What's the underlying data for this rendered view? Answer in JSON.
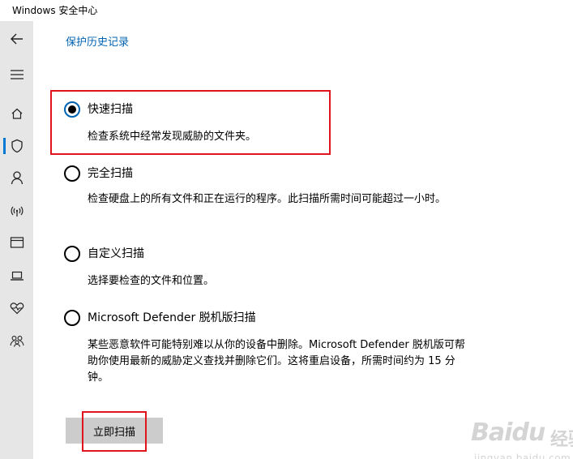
{
  "window": {
    "title": "Windows 安全中心"
  },
  "sidebar": {
    "items": [
      {
        "icon": "back-arrow-icon"
      },
      {
        "icon": "hamburger-menu-icon"
      },
      {
        "icon": "home-icon"
      },
      {
        "icon": "shield-icon",
        "active": true
      },
      {
        "icon": "person-icon"
      },
      {
        "icon": "network-icon"
      },
      {
        "icon": "app-browser-icon"
      },
      {
        "icon": "laptop-icon"
      },
      {
        "icon": "heart-health-icon"
      },
      {
        "icon": "family-icon"
      }
    ]
  },
  "content": {
    "history_link": "保护历史记录",
    "options": [
      {
        "label": "快速扫描",
        "description": "检查系统中经常发现威胁的文件夹。",
        "selected": true
      },
      {
        "label": "完全扫描",
        "description": "检查硬盘上的所有文件和正在运行的程序。此扫描所需时间可能超过一小时。",
        "selected": false
      },
      {
        "label": "自定义扫描",
        "description": "选择要检查的文件和位置。",
        "selected": false
      },
      {
        "label": "Microsoft Defender 脱机版扫描",
        "description": "某些恶意软件可能特别难以从你的设备中删除。Microsoft Defender 脱机版可帮助你使用最新的威胁定义查找并删除它们。这将重启设备，所需时间约为 15 分钟。",
        "selected": false
      }
    ],
    "scan_button": "立即扫描"
  },
  "watermark": {
    "main": "Baidu",
    "cn": "经验",
    "url": "jingyan.baidu.com"
  },
  "colors": {
    "accent": "#0078d4",
    "link": "#0063b1",
    "highlight": "#e0141c",
    "sidebar_bg": "#e6e6e6",
    "button_bg": "#cccccc"
  }
}
